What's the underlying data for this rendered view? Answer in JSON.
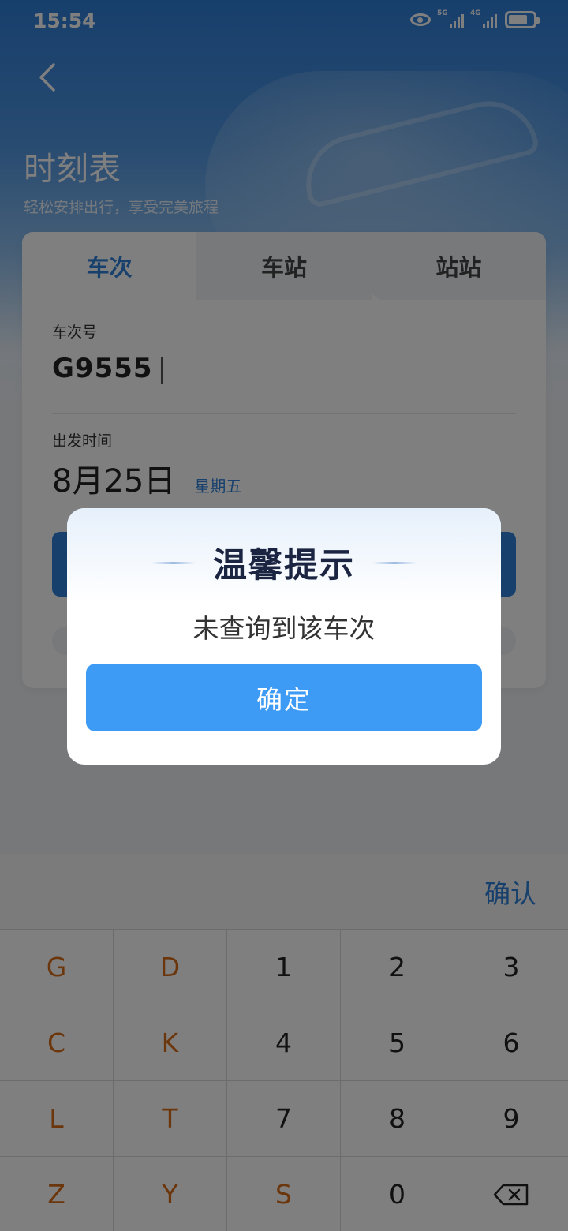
{
  "status_bar": {
    "time": "15:54",
    "signal1_tag": "5G",
    "signal2_tag": "4G"
  },
  "header": {
    "title": "时刻表",
    "subtitle": "轻松安排出行，享受完美旅程"
  },
  "tabs": [
    {
      "label": "车次",
      "active": true
    },
    {
      "label": "车站",
      "active": false
    },
    {
      "label": "站站",
      "active": false
    }
  ],
  "form": {
    "train_label": "车次号",
    "train_value": "G9555",
    "date_label": "出发时间",
    "date_value": "8月25日",
    "weekday": "星期五"
  },
  "keyboard": {
    "confirm_label": "确认",
    "keys": [
      "G",
      "D",
      "1",
      "2",
      "3",
      "C",
      "K",
      "4",
      "5",
      "6",
      "L",
      "T",
      "7",
      "8",
      "9",
      "Z",
      "Y",
      "S",
      "0",
      "backspace-icon"
    ],
    "letter_color": "#d96d19"
  },
  "dialog": {
    "title": "温馨提示",
    "message": "未查询到该车次",
    "ok_label": "确定"
  },
  "colors": {
    "accent": "#2f80d8",
    "dialog_button": "#3d9bf6"
  }
}
